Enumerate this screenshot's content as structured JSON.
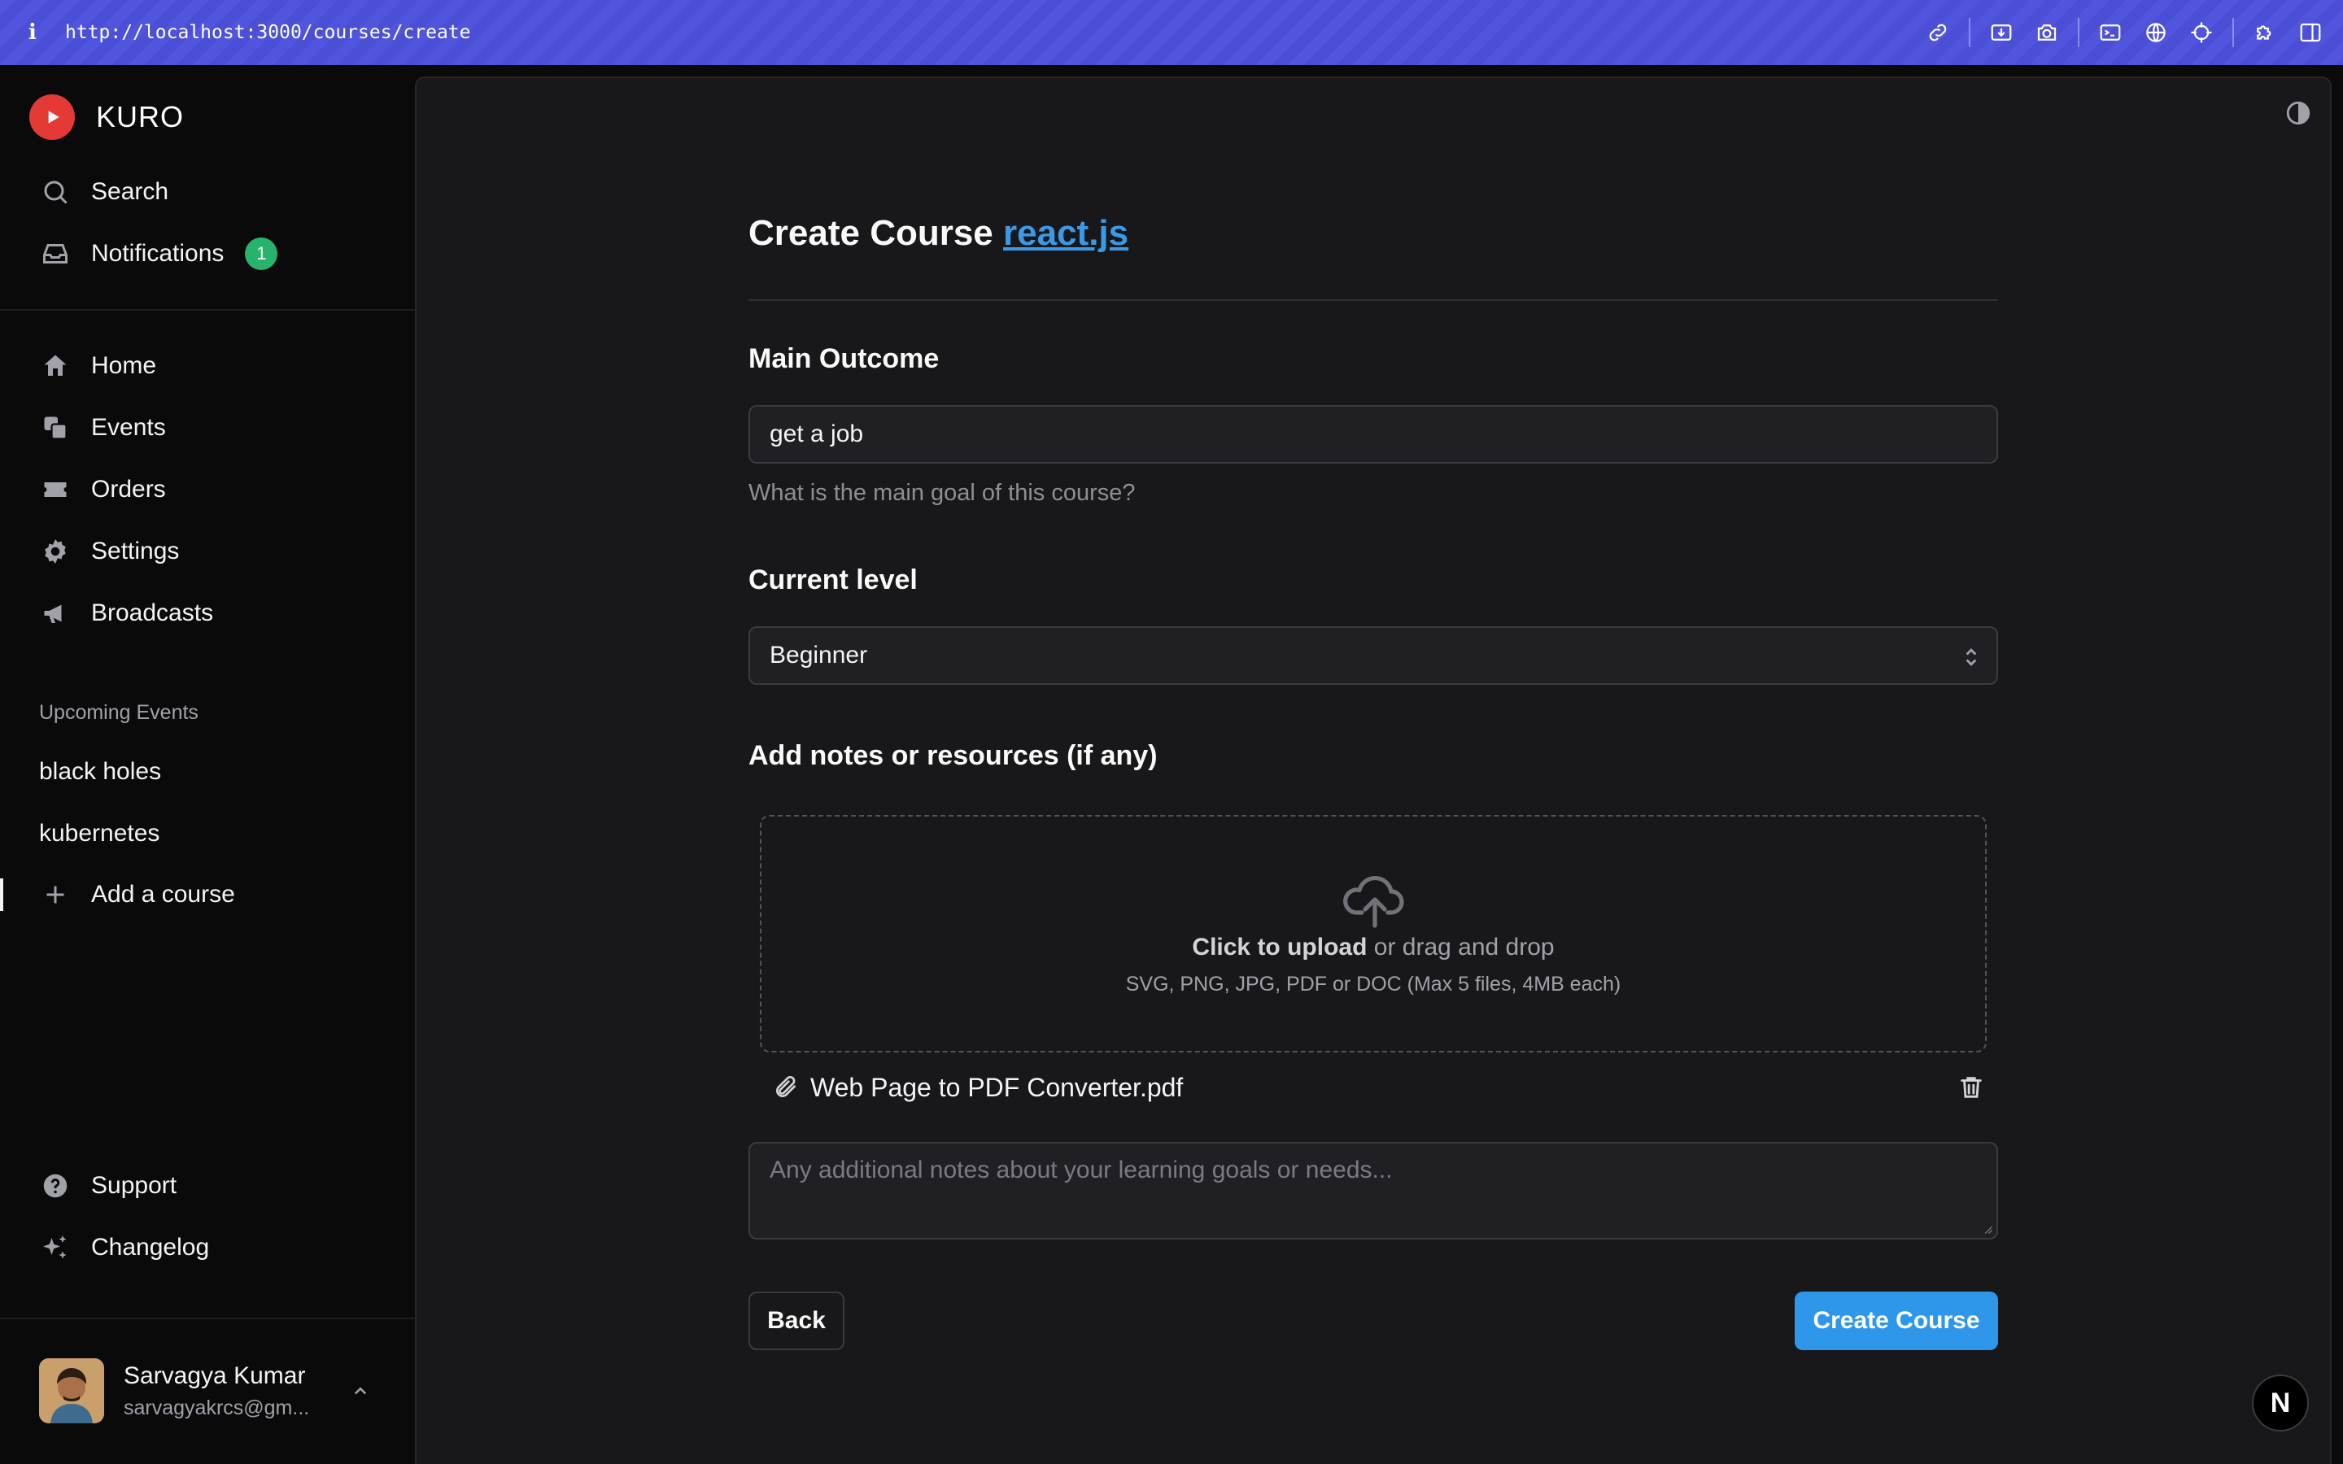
{
  "browser": {
    "info_glyph": "i",
    "url": "http://localhost:3000/courses/create",
    "tools": [
      "link-icon",
      "screenshot-region-icon",
      "camera-icon",
      "terminal-icon",
      "globe-icon",
      "crosshair-icon",
      "puzzle-icon",
      "sidebar-icon"
    ]
  },
  "sidebar": {
    "brand": "KURO",
    "search_label": "Search",
    "notifications_label": "Notifications",
    "notifications_count": "1",
    "nav": [
      "Home",
      "Events",
      "Orders",
      "Settings",
      "Broadcasts"
    ],
    "upcoming_label": "Upcoming Events",
    "upcoming": [
      "black holes",
      "kubernetes"
    ],
    "add_course": "Add a course",
    "support": "Support",
    "changelog": "Changelog",
    "user": {
      "name": "Sarvagya Kumar",
      "email": "sarvagyakrcs@gm..."
    }
  },
  "form": {
    "title": "Create Course",
    "title_link": "react.js",
    "outcome_label": "Main Outcome",
    "outcome_value": "get a job",
    "outcome_helper": "What is the main goal of this course?",
    "level_label": "Current level",
    "level_value": "Beginner",
    "notes_label": "Add notes or resources (if any)",
    "upload_strong": "Click to upload",
    "upload_rest": " or drag and drop",
    "upload_hint": "SVG, PNG, JPG, PDF or DOC (Max 5 files, 4MB each)",
    "file_name": "Web Page to PDF Converter.pdf",
    "notes_placeholder": "Any additional notes about your learning goals or needs...",
    "back_label": "Back",
    "create_label": "Create Course"
  },
  "colors": {
    "accent": "#2f97ea",
    "brand": "#e53935",
    "badge": "#27b36b",
    "topbar": "#4b4fd6"
  },
  "next_badge": "N"
}
